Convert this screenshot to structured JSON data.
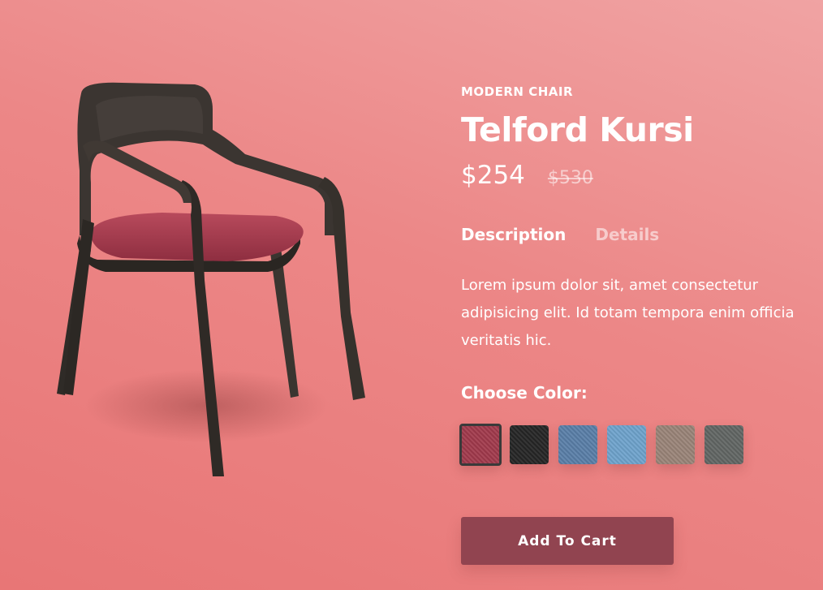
{
  "product": {
    "category": "MODERN CHAIR",
    "name": "Telford Kursi",
    "price": "$254",
    "old_price": "$530",
    "tabs": [
      {
        "label": "Description",
        "active": true
      },
      {
        "label": "Details",
        "active": false
      }
    ],
    "description": "Lorem ipsum dolor sit, amet consectetur adipisicing elit. Id totam tempora enim officia veritatis hic.",
    "color_label": "Choose Color:",
    "colors": [
      {
        "name": "red-fabric",
        "hex": "#a13a4c",
        "selected": true
      },
      {
        "name": "black-fabric",
        "hex": "#262626",
        "selected": false
      },
      {
        "name": "denim-blue-fabric",
        "hex": "#5a7fa8",
        "selected": false
      },
      {
        "name": "sky-blue-fabric",
        "hex": "#6fa3cc",
        "selected": false
      },
      {
        "name": "taupe-fabric",
        "hex": "#9a8478",
        "selected": false
      },
      {
        "name": "gray-fabric",
        "hex": "#626664",
        "selected": false
      }
    ],
    "add_to_cart_label": "Add To Cart",
    "accent_color": "#914450",
    "background_color": "#ec8787"
  }
}
